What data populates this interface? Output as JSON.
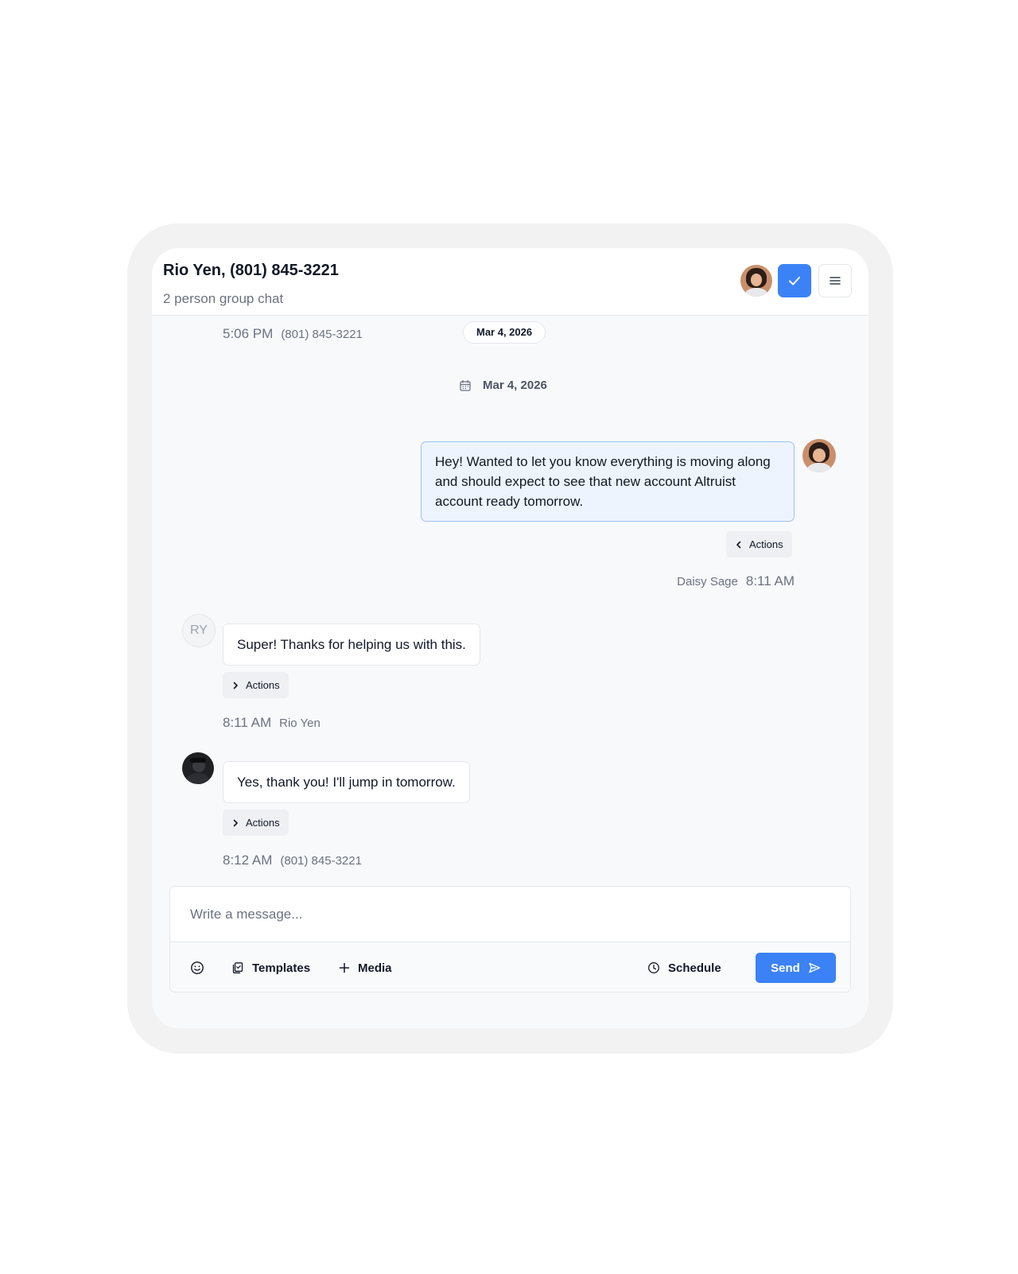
{
  "header": {
    "title": "Rio Yen, (801) 845-3221",
    "subtitle": "2 person group chat"
  },
  "top_meta": {
    "time": "5:06 PM",
    "sender": "(801) 845-3221"
  },
  "date_pill": "Mar 4, 2026",
  "date_separator": "Mar 4, 2026",
  "messages": [
    {
      "direction": "outgoing",
      "text": "Hey! Wanted to let you know everything is moving along and should expect to see that new account Altruist account ready tomorrow.",
      "actions_label": "Actions",
      "sender": "Daisy Sage",
      "time": "8:11 AM"
    },
    {
      "direction": "incoming",
      "avatar_initials": "RY",
      "text": "Super! Thanks for helping us with this.",
      "actions_label": "Actions",
      "time": "8:11 AM",
      "sender": "Rio Yen"
    },
    {
      "direction": "incoming",
      "text": "Yes, thank you! I'll jump in tomorrow.",
      "actions_label": "Actions",
      "time": "8:12 AM",
      "sender": "(801) 845-3221"
    }
  ],
  "composer": {
    "placeholder": "Write a message...",
    "templates_label": "Templates",
    "media_label": "Media",
    "schedule_label": "Schedule",
    "send_label": "Send"
  },
  "colors": {
    "accent": "#3b82f6",
    "outgoing_bubble": "#eef4fd",
    "outgoing_border": "#9cc0f5"
  },
  "icons": [
    "check-icon",
    "menu-icon",
    "calendar-icon",
    "chevron-left-icon",
    "chevron-right-icon",
    "emoji-icon",
    "templates-icon",
    "plus-icon",
    "clock-icon",
    "send-icon"
  ]
}
